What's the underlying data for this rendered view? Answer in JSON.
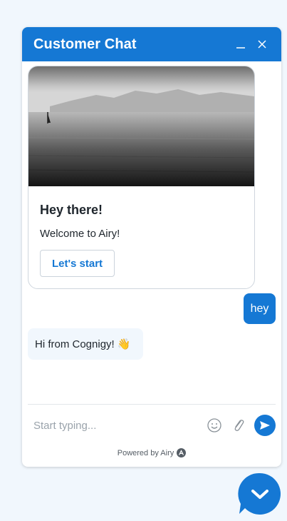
{
  "header": {
    "title": "Customer Chat"
  },
  "card": {
    "title": "Hey there!",
    "text": "Welcome to Airy!",
    "button_label": "Let's start"
  },
  "messages": [
    {
      "sender": "user",
      "text": "hey"
    },
    {
      "sender": "bot",
      "text": "Hi from Cognigy! 👋"
    }
  ],
  "composer": {
    "placeholder": "Start typing..."
  },
  "footer": {
    "powered_by": "Powered by Airy"
  },
  "colors": {
    "accent": "#1578d4",
    "background": "#f1f7fd",
    "text": "#1f262d"
  },
  "icons": [
    "minimize-icon",
    "close-icon",
    "emoji-icon",
    "attachment-icon",
    "send-icon",
    "airy-logo-icon",
    "chevron-down-icon"
  ]
}
